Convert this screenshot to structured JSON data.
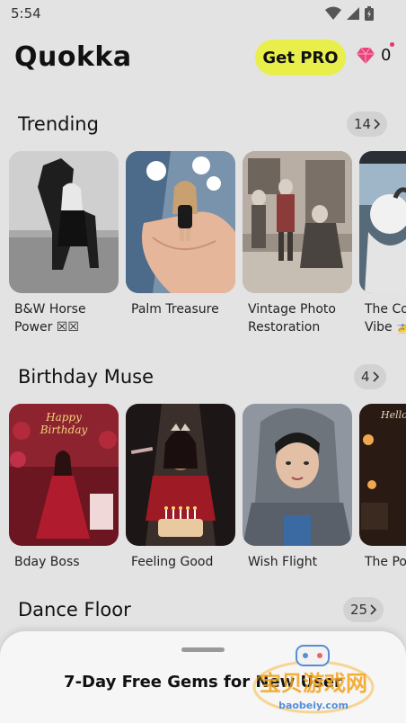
{
  "status_bar": {
    "time": "5:54"
  },
  "header": {
    "title": "Quokka",
    "pro_label": "Get PRO",
    "gem_count": "0",
    "accent": "#e8ef4a"
  },
  "sections": [
    {
      "title": "Trending",
      "count": "14",
      "items": [
        {
          "label": "B&W Horse\nPower ☒☒"
        },
        {
          "label": "Palm Treasure"
        },
        {
          "label": "Vintage Photo\nRestoration"
        },
        {
          "label": "The Co\nVibe 🚁"
        }
      ]
    },
    {
      "title": "Birthday Muse",
      "count": "4",
      "items": [
        {
          "label": "Bday Boss",
          "overlay": "Happy Birthday"
        },
        {
          "label": "Feeling Good"
        },
        {
          "label": "Wish Flight"
        },
        {
          "label": "The Po",
          "overlay": "Hello, a new"
        }
      ]
    },
    {
      "title": "Dance Floor",
      "count": "25"
    }
  ],
  "bottom_sheet": {
    "title": "7-Day Free Gems for New User"
  },
  "watermark": {
    "text": "宝贝游戏网",
    "url": "baobeiy.com"
  }
}
